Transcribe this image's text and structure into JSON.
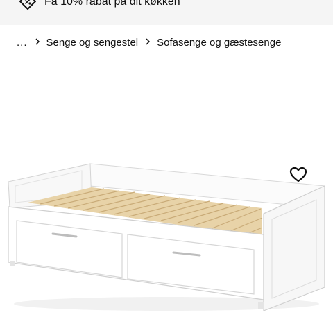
{
  "promo": {
    "icon": "tag-percent-icon",
    "link_text": "Få 10% rabat på dit køkken"
  },
  "breadcrumb": {
    "ellipsis": "...",
    "items": [
      {
        "label": "Senge og sengestel"
      },
      {
        "label": "Sofasenge og gæstesenge"
      }
    ]
  },
  "product": {
    "image": "white-daybed-with-two-drawers",
    "favorite_icon": "heart-outline-icon"
  },
  "colors": {
    "promo_bg": "#f5f5f5",
    "text": "#111111",
    "bed_white": "#ffffff",
    "slat_wood": "#e8d3a8"
  }
}
